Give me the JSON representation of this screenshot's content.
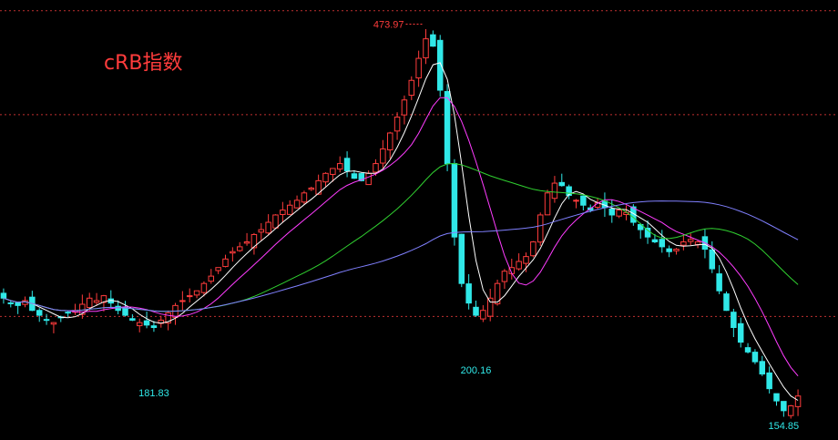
{
  "chart_data": {
    "type": "candlestick",
    "title": "cRB指数",
    "y_range": [
      140,
      490
    ],
    "annotations": {
      "high": {
        "value": 473.97,
        "label": "473.97"
      },
      "low1": {
        "value": 181.83,
        "label": "181.83"
      },
      "low2": {
        "value": 200.16,
        "label": "200.16"
      },
      "low3": {
        "value": 154.85,
        "label": "154.85"
      }
    },
    "reference_lines": [
      {
        "value": 485,
        "color": "#c03030"
      },
      {
        "value": 400,
        "color": "#c03030"
      },
      {
        "value": 235,
        "color": "#c03030"
      }
    ],
    "closes": [
      250,
      246,
      244,
      248,
      240,
      236,
      232,
      230,
      234,
      238,
      240,
      245,
      250,
      248,
      252,
      246,
      240,
      236,
      232,
      230,
      228,
      226,
      232,
      238,
      244,
      248,
      252,
      256,
      262,
      268,
      275,
      282,
      288,
      292,
      296,
      302,
      306,
      312,
      318,
      322,
      326,
      330,
      336,
      340,
      346,
      352,
      356,
      360,
      354,
      348,
      346,
      352,
      360,
      372,
      385,
      398,
      412,
      428,
      446,
      462,
      456,
      420,
      360,
      300,
      262,
      246,
      236,
      240,
      250,
      262,
      272,
      275,
      280,
      284,
      296,
      318,
      336,
      344,
      342,
      334,
      330,
      326,
      322,
      328,
      324,
      318,
      322,
      320,
      312,
      306,
      300,
      296,
      292,
      288,
      290,
      296,
      298,
      296,
      290,
      274,
      256,
      240,
      226,
      214,
      206,
      198,
      188,
      176,
      166,
      158,
      162,
      170
    ],
    "series": [
      {
        "name": "MA5",
        "color": "#ffffff",
        "values": []
      },
      {
        "name": "MA10",
        "color": "#ff3cff",
        "values": []
      },
      {
        "name": "MA30",
        "color": "#30d030",
        "values": []
      },
      {
        "name": "MA120",
        "color": "#8080ff",
        "values": []
      }
    ],
    "colors": {
      "up": "#ff3c3c",
      "down": "#30e8e8"
    }
  }
}
